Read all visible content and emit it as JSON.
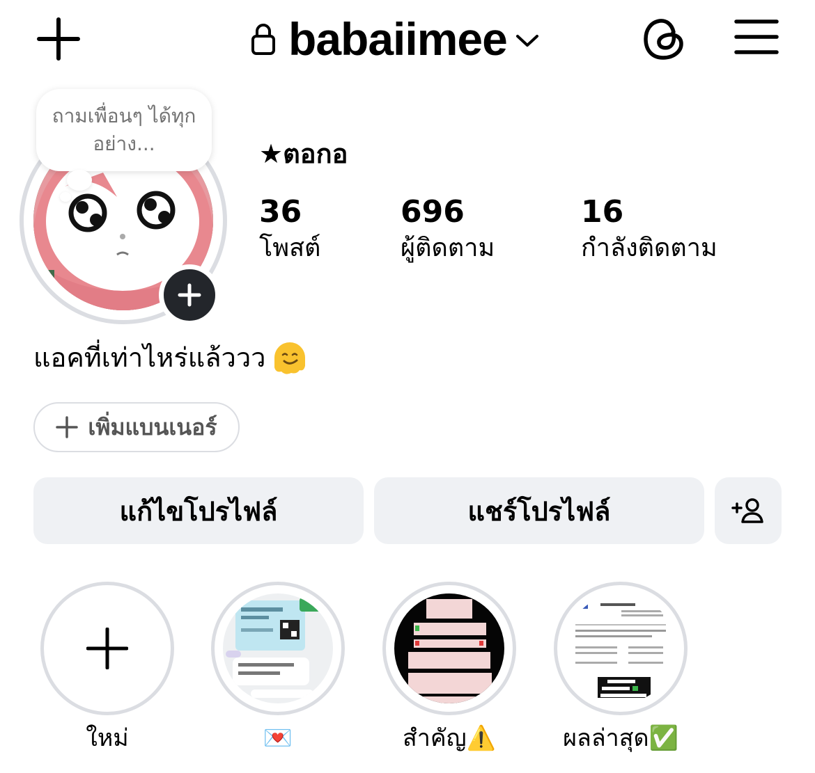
{
  "header": {
    "username": "babaiimee",
    "icons": [
      "plus-icon",
      "lock-icon",
      "chevron-down-icon",
      "threads-icon",
      "hamburger-menu-icon"
    ]
  },
  "profile": {
    "note": "ถามเพื่อนๆ ได้ทุกอย่าง...",
    "display_name": "★ตอกอ",
    "stats": [
      {
        "value": "36",
        "label": "โพสต์"
      },
      {
        "value": "696",
        "label": "ผู้ติดตาม"
      },
      {
        "value": "16",
        "label": "กำลังติดตาม"
      }
    ],
    "bio": "แอคที่เท่าไหร่แล้ววว",
    "bio_emoji": "melting-face-icon"
  },
  "banner": {
    "label": "เพิ่มแบนเนอร์"
  },
  "actions": {
    "edit_profile": "แก้ไขโปรไฟล์",
    "share_profile": "แชร์โปรไฟล์",
    "add_person_icon": "add-person-icon"
  },
  "highlights": [
    {
      "label": "ใหม่"
    },
    {
      "label": "💌"
    },
    {
      "label": "สำคัญ⚠️"
    },
    {
      "label": "ผลล่าสุด✅"
    }
  ],
  "colors": {
    "button_bg": "#eff1f4",
    "ring": "#dbdde2",
    "muted_text": "#737373"
  }
}
